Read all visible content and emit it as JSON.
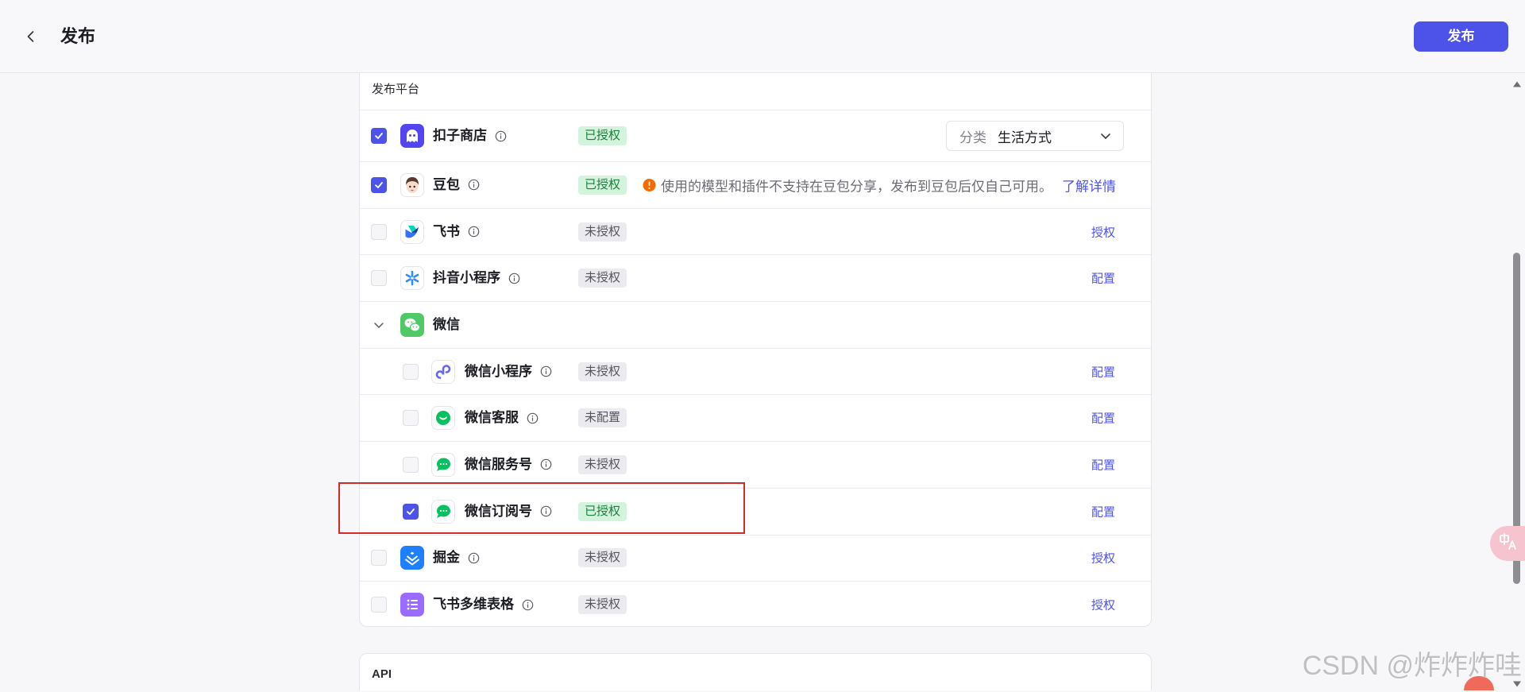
{
  "header": {
    "title": "发布",
    "back_icon": "chevron-left-icon",
    "publish_label": "发布"
  },
  "platforms": {
    "section_label": "发布平台",
    "items": [
      {
        "name": "扣子商店",
        "checked": true,
        "badge": "已授权",
        "badge_tone": "green",
        "icon": "coze-store-icon",
        "category_label": "分类",
        "category_value": "生活方式"
      },
      {
        "name": "豆包",
        "checked": true,
        "badge": "已授权",
        "badge_tone": "green",
        "icon": "doubao-icon",
        "warning": "使用的模型和插件不支持在豆包分享，发布到豆包后仅自己可用。",
        "link": "了解详情"
      },
      {
        "name": "飞书",
        "checked": false,
        "badge": "未授权",
        "badge_tone": "gray",
        "icon": "feishu-icon",
        "action": "授权"
      },
      {
        "name": "抖音小程序",
        "checked": false,
        "badge": "未授权",
        "badge_tone": "gray",
        "icon": "douyin-mini-program-icon",
        "action": "配置"
      },
      {
        "name": "微信",
        "expanded": true,
        "icon": "wechat-icon",
        "children": [
          {
            "name": "微信小程序",
            "checked": false,
            "badge": "未授权",
            "badge_tone": "gray",
            "icon": "wechat-mini-program-icon",
            "action": "配置"
          },
          {
            "name": "微信客服",
            "checked": false,
            "badge": "未配置",
            "badge_tone": "gray",
            "icon": "wechat-customer-service-icon",
            "action": "配置"
          },
          {
            "name": "微信服务号",
            "checked": false,
            "badge": "未授权",
            "badge_tone": "gray",
            "icon": "wechat-service-account-icon",
            "action": "配置"
          },
          {
            "name": "微信订阅号",
            "checked": true,
            "badge": "已授权",
            "badge_tone": "green",
            "icon": "wechat-subscription-account-icon",
            "action": "配置"
          }
        ]
      },
      {
        "name": "掘金",
        "checked": false,
        "badge": "未授权",
        "badge_tone": "gray",
        "icon": "juejin-icon",
        "action": "授权"
      },
      {
        "name": "飞书多维表格",
        "checked": false,
        "badge": "未授权",
        "badge_tone": "gray",
        "icon": "feishu-bitable-icon",
        "action": "授权"
      }
    ]
  },
  "api": {
    "title": "API"
  },
  "watermark": "CSDN @炸炸炸哇",
  "colors": {
    "accent": "#4D53E8",
    "badge_green_bg": "#D3F3DD",
    "badge_green_text": "#1A7F3C",
    "badge_gray_bg": "#EBEBEF",
    "badge_gray_text": "#55555E",
    "warning": "#F76A00",
    "highlight": "#D42A2A"
  }
}
